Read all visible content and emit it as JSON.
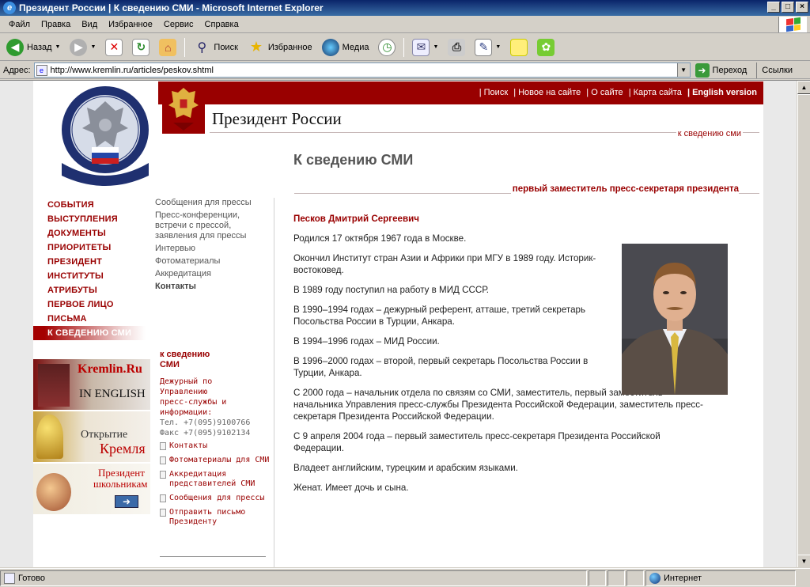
{
  "window": {
    "title": "Президент России | К сведению СМИ - Microsoft Internet Explorer",
    "min": "_",
    "max": "□",
    "close": "×"
  },
  "menu": [
    "Файл",
    "Правка",
    "Вид",
    "Избранное",
    "Сервис",
    "Справка"
  ],
  "toolbar": {
    "back": "Назад",
    "search": "Поиск",
    "favorites": "Избранное",
    "media": "Медиа"
  },
  "address": {
    "label": "Адрес:",
    "url": "http://www.kremlin.ru/articles/peskov.shtml",
    "go": "Переход",
    "links": "Ссылки"
  },
  "site": {
    "title": "Президент России",
    "top_links": [
      "| Поиск",
      "| Новое на сайте",
      "| О сайте",
      "| Карта сайта",
      "| English version"
    ],
    "section_crumb": "к сведению сми",
    "heading": "К сведению СМИ",
    "subtitle": "первый заместитель пресс-секретаря президента"
  },
  "left_nav": [
    "СОБЫТИЯ",
    "ВЫСТУПЛЕНИЯ",
    "ДОКУМЕНТЫ",
    "ПРИОРИТЕТЫ",
    "ПРЕЗИДЕНТ",
    "ИНСТИТУТЫ",
    "АТРИБУТЫ",
    "ПЕРВОЕ ЛИЦО",
    "ПИСЬМА",
    "К СВЕДЕНИЮ СМИ"
  ],
  "sub_nav": [
    "Сообщения для прессы",
    "Пресс-конференции, встречи с прессой, заявления для прессы",
    "Интервью",
    "Фотоматериалы",
    "Аккредитация",
    "Контакты"
  ],
  "banners": {
    "kremlin_ru": "Kremlin.Ru",
    "in_english": "IN ENGLISH",
    "otkrytie": "Открытие",
    "kremlya": "Кремля",
    "prezident": "Президент",
    "shkolnikam": "школьникам",
    "arrow": "➜"
  },
  "press": {
    "title": "к сведению СМИ",
    "duty": "Дежурный по Управлению пресс-службы и информации:",
    "tel": "Тел. +7(095)9100766",
    "fax": "Факс +7(095)9102134",
    "links": [
      "Контакты",
      "Фотоматериалы для СМИ",
      "Аккредитация представителей СМИ",
      "Сообщения для прессы",
      "Отправить письмо Президенту"
    ]
  },
  "article": {
    "name": "Песков Дмитрий Сергеевич",
    "paragraphs": [
      "Родился 17 октября 1967 года в Москве.",
      "Окончил Институт стран Азии и Африки при МГУ в 1989 году. Историк-востоковед.",
      "В 1989 году поступил на работу в МИД СССР.",
      "В 1990–1994 годах – дежурный референт, атташе, третий секретарь Посольства России в Турции, Анкара.",
      "В 1994–1996 годах – МИД России.",
      "В 1996–2000 годах – второй, первый секретарь Посольства России в Турции, Анкара.",
      "С 2000 года – начальник отдела по связям со СМИ, заместитель, первый заместитель начальника Управления пресс-службы Президента Российской Федерации, заместитель пресс-секретаря Президента Российской Федерации.",
      "С 9 апреля 2004 года – первый заместитель пресс-секретаря Президента Российской Федерации.",
      "Владеет английским, турецким и арабским языками.",
      "Женат. Имеет дочь и сына."
    ]
  },
  "status": {
    "ready": "Готово",
    "zone": "Интернет"
  },
  "colors": {
    "brand_red": "#990000",
    "title_blue": "#0a246a"
  }
}
